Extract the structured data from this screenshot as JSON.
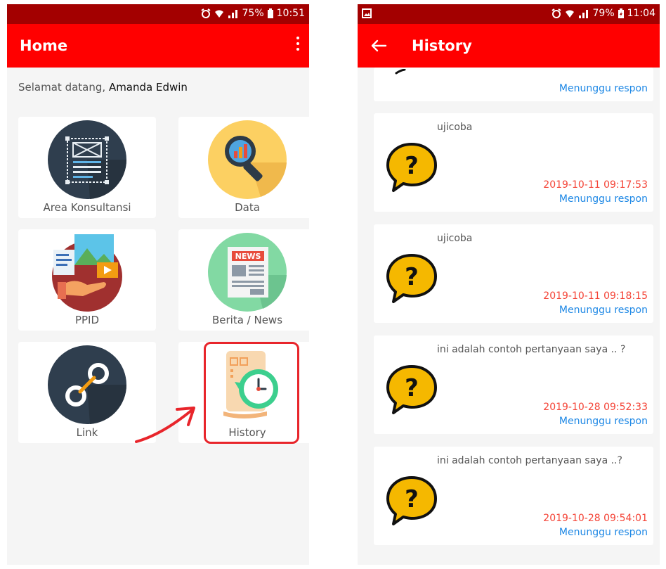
{
  "left": {
    "status": {
      "battery": "75%",
      "time": "10:51"
    },
    "appbar": {
      "title": "Home"
    },
    "greeting": {
      "prefix": "Selamat datang,",
      "name": "Amanda Edwin"
    },
    "tiles": [
      {
        "label": "Area Konsultansi",
        "icon": "wireframe-document-icon"
      },
      {
        "label": "Data",
        "icon": "magnifier-chart-icon"
      },
      {
        "label": "PPID",
        "icon": "media-hand-icon"
      },
      {
        "label": "Berita / News",
        "icon": "newspaper-icon"
      },
      {
        "label": "Link",
        "icon": "chain-link-icon"
      },
      {
        "label": "History",
        "icon": "scroll-clock-icon"
      }
    ],
    "newspaper_word": "NEWS"
  },
  "right": {
    "status": {
      "battery": "79%",
      "time": "11:04"
    },
    "appbar": {
      "title": "History"
    },
    "items": [
      {
        "question": "",
        "date": "",
        "status": "Menunggu respon"
      },
      {
        "question": "ujicoba",
        "date": "2019-10-11 09:17:53",
        "status": "Menunggu respon"
      },
      {
        "question": "ujicoba",
        "date": "2019-10-11 09:18:15",
        "status": "Menunggu respon"
      },
      {
        "question": "ini adalah contoh pertanyaan saya .. ?",
        "date": "2019-10-28 09:52:33",
        "status": "Menunggu respon"
      },
      {
        "question": "ini adalah contoh pertanyaan saya ..?",
        "date": "2019-10-28 09:54:01",
        "status": "Menunggu respon"
      }
    ],
    "question_glyph": "?"
  },
  "colors": {
    "appbar": "#ff0000",
    "statusbar": "#a30000",
    "date": "#f44336",
    "status_link": "#1e88e5",
    "highlight": "#e8252b"
  }
}
